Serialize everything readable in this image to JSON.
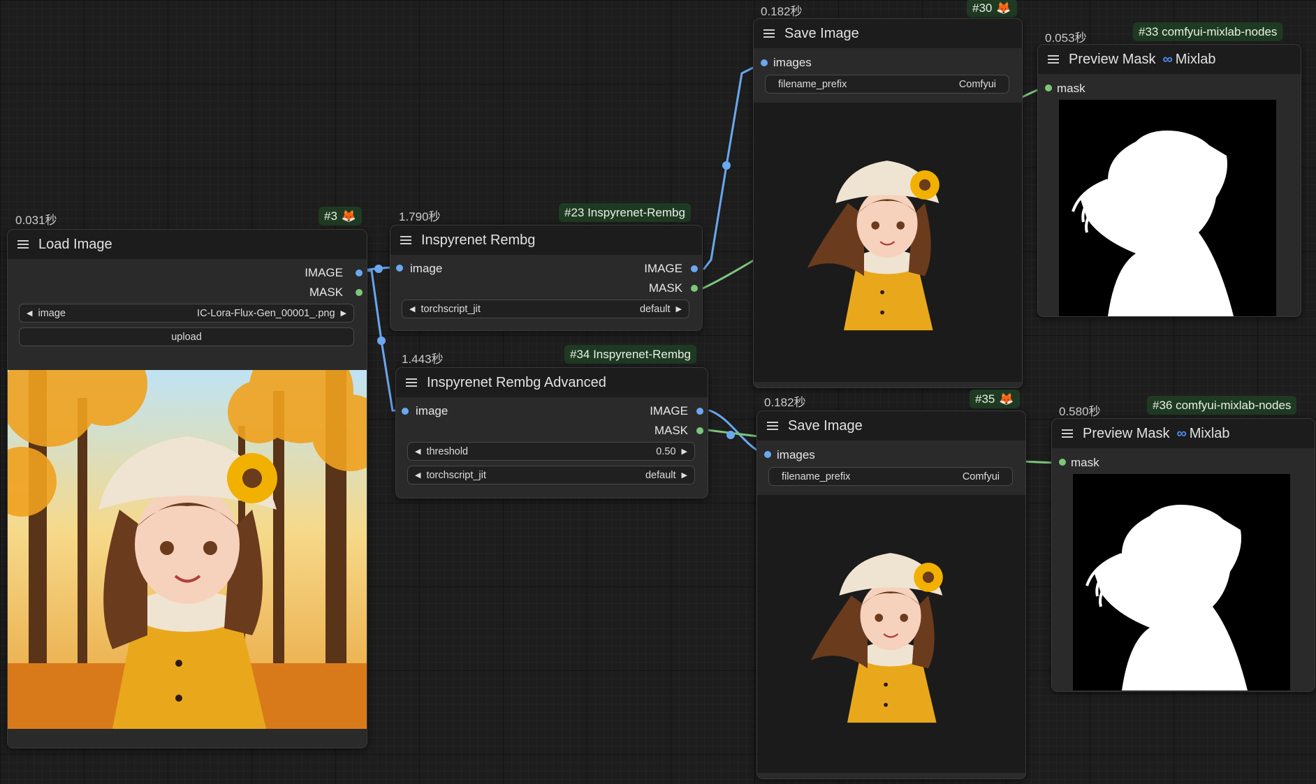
{
  "nodes": {
    "load_image": {
      "timing": "0.031秒",
      "badge_id": "#3",
      "title": "Load Image",
      "out_image": "IMAGE",
      "out_mask": "MASK",
      "widget_image_name": "image",
      "widget_image_value": "IC-Lora-Flux-Gen_00001_.png",
      "upload_label": "upload"
    },
    "rembg23": {
      "timing": "1.790秒",
      "badge": "#23 Inspyrenet-Rembg",
      "title": "Inspyrenet Rembg",
      "in_image": "image",
      "out_image": "IMAGE",
      "out_mask": "MASK",
      "widget_name": "torchscript_jit",
      "widget_value": "default"
    },
    "rembg34": {
      "timing": "1.443秒",
      "badge": "#34 Inspyrenet-Rembg",
      "title": "Inspyrenet Rembg Advanced",
      "in_image": "image",
      "out_image": "IMAGE",
      "out_mask": "MASK",
      "threshold_name": "threshold",
      "threshold_value": "0.50",
      "jit_name": "torchscript_jit",
      "jit_value": "default"
    },
    "save30": {
      "timing": "0.182秒",
      "badge_id": "#30",
      "title": "Save Image",
      "in_images": "images",
      "prefix_name": "filename_prefix",
      "prefix_value": "Comfyui"
    },
    "save35": {
      "timing": "0.182秒",
      "badge_id": "#35",
      "title": "Save Image",
      "in_images": "images",
      "prefix_name": "filename_prefix",
      "prefix_value": "Comfyui"
    },
    "preview33": {
      "timing": "0.053秒",
      "badge": "#33 comfyui-mixlab-nodes",
      "title": "Preview Mask",
      "brand": "Mixlab",
      "brand_symbol": "∞",
      "in_mask": "mask"
    },
    "preview36": {
      "timing": "0.580秒",
      "badge": "#36 comfyui-mixlab-nodes",
      "title": "Preview Mask",
      "brand": "Mixlab",
      "brand_symbol": "∞",
      "in_mask": "mask"
    }
  },
  "icons": {
    "fox": "🦊",
    "arrow_left": "◀",
    "arrow_right": "▶",
    "menu": "hamburger-menu-icon"
  },
  "colors": {
    "image_wire": "#6aa8f0",
    "mask_wire": "#7cc67c",
    "badge_bg": "#1f3a22",
    "mixlab_accent": "#4d8cf0"
  }
}
